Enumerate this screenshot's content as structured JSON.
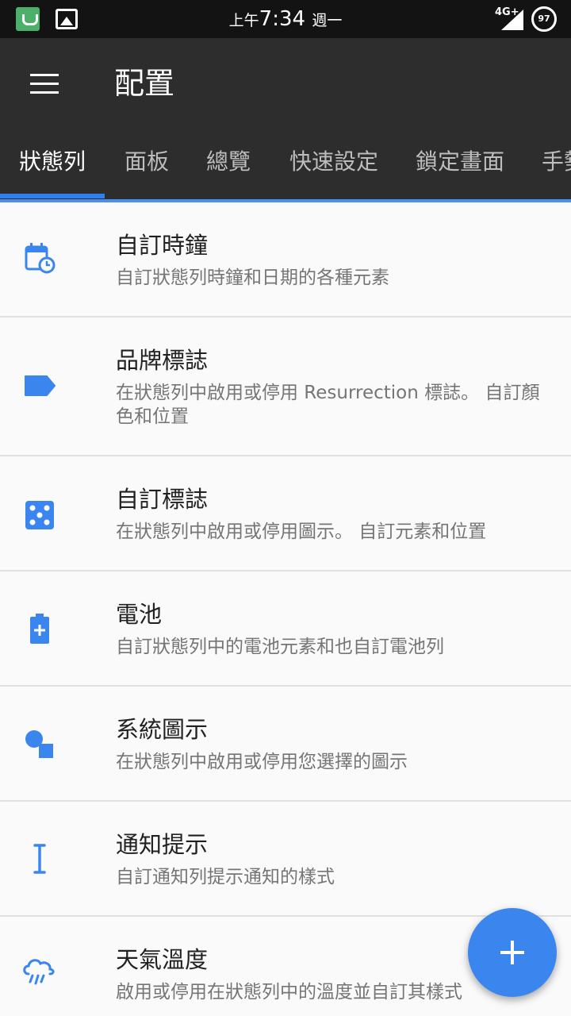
{
  "status_bar": {
    "time_prefix": "上午",
    "time": "7:34",
    "weekday": "週一",
    "network": "4G+",
    "battery": "97"
  },
  "app_bar": {
    "title": "配置"
  },
  "tabs": [
    {
      "label": "狀態列",
      "active": true
    },
    {
      "label": "面板"
    },
    {
      "label": "總覽"
    },
    {
      "label": "快速設定"
    },
    {
      "label": "鎖定畫面"
    },
    {
      "label": "手勢"
    }
  ],
  "items": [
    {
      "icon": "calendar-clock-icon",
      "title": "自訂時鐘",
      "subtitle": "自訂狀態列時鐘和日期的各種元素"
    },
    {
      "icon": "label-icon",
      "title": "品牌標誌",
      "subtitle": "在狀態列中啟用或停用 Resurrection 標誌。 自訂顏色和位置"
    },
    {
      "icon": "dice-icon",
      "title": "自訂標誌",
      "subtitle": "在狀態列中啟用或停用圖示。 自訂元素和位置"
    },
    {
      "icon": "battery-plus-icon",
      "title": "電池",
      "subtitle": "自訂狀態列中的電池元素和也自訂電池列"
    },
    {
      "icon": "shapes-icon",
      "title": "系統圖示",
      "subtitle": "在狀態列中啟用或停用您選擇的圖示"
    },
    {
      "icon": "text-cursor-icon",
      "title": "通知提示",
      "subtitle": "自訂通知列提示通知的樣式"
    },
    {
      "icon": "weather-rain-icon",
      "title": "天氣溫度",
      "subtitle": "啟用或停用在狀態列中的溫度並自訂其樣式"
    }
  ],
  "colors": {
    "accent": "#3b86ee",
    "icon": "#3b86ee",
    "app_bar": "#2d2d2d"
  },
  "fab": {
    "icon": "plus-icon"
  }
}
